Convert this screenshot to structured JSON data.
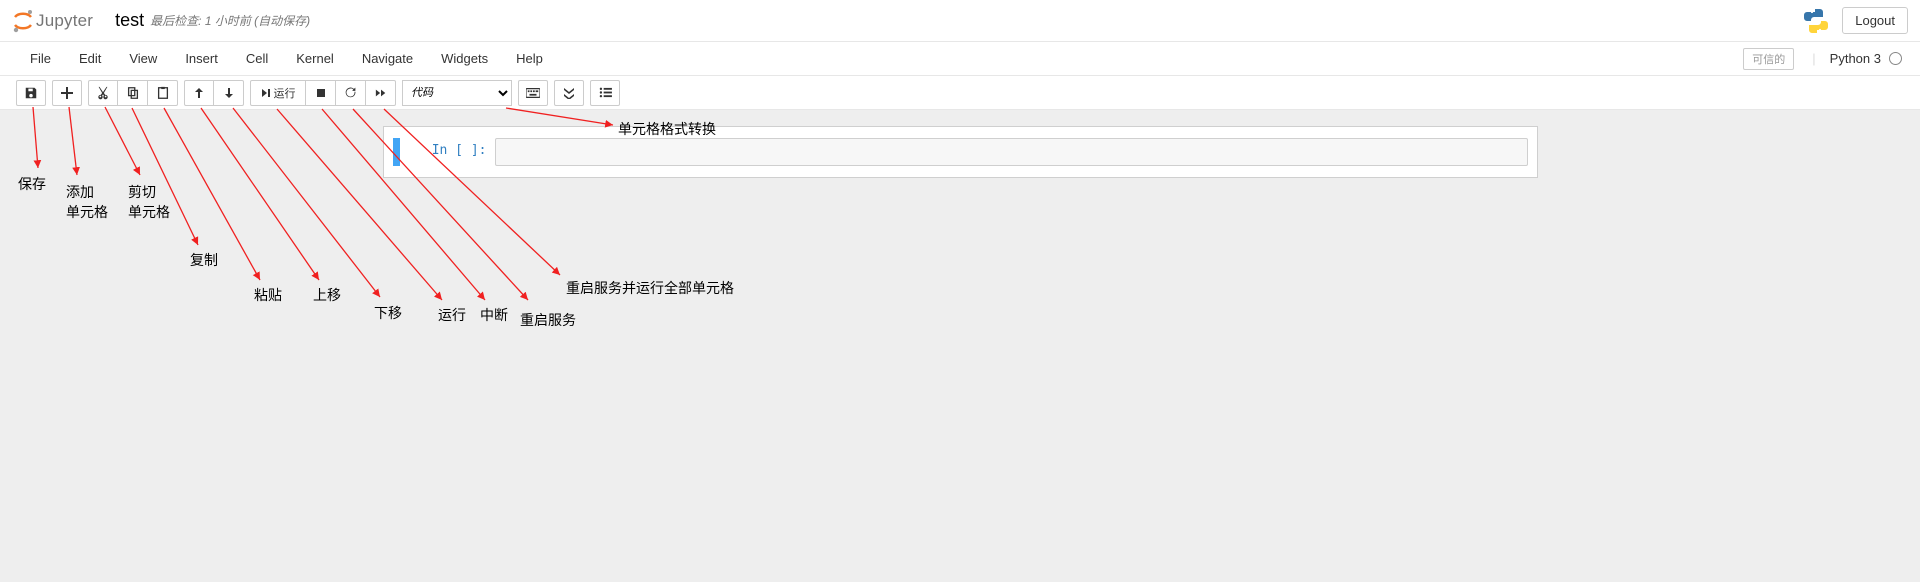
{
  "header": {
    "brand": "Jupyter",
    "title": "test",
    "checkpoint": "最后检查: 1 小时前  (自动保存)",
    "logout": "Logout"
  },
  "menu": {
    "items": [
      "File",
      "Edit",
      "View",
      "Insert",
      "Cell",
      "Kernel",
      "Navigate",
      "Widgets",
      "Help"
    ],
    "trusted": "可信的",
    "kernel": "Python 3"
  },
  "toolbar": {
    "run_label": "运行",
    "cell_type": "代码"
  },
  "cell": {
    "prompt": "In [ ]:"
  },
  "annotations": {
    "save": "保存",
    "add": "添加\n单元格",
    "cut": "剪切\n单元格",
    "copy": "复制",
    "paste": "粘贴",
    "up": "上移",
    "down": "下移",
    "run": "运行",
    "interrupt": "中断",
    "restart": "重启服务",
    "restart_run_all": "重启服务并运行全部单元格",
    "cell_format": "单元格格式转换"
  }
}
